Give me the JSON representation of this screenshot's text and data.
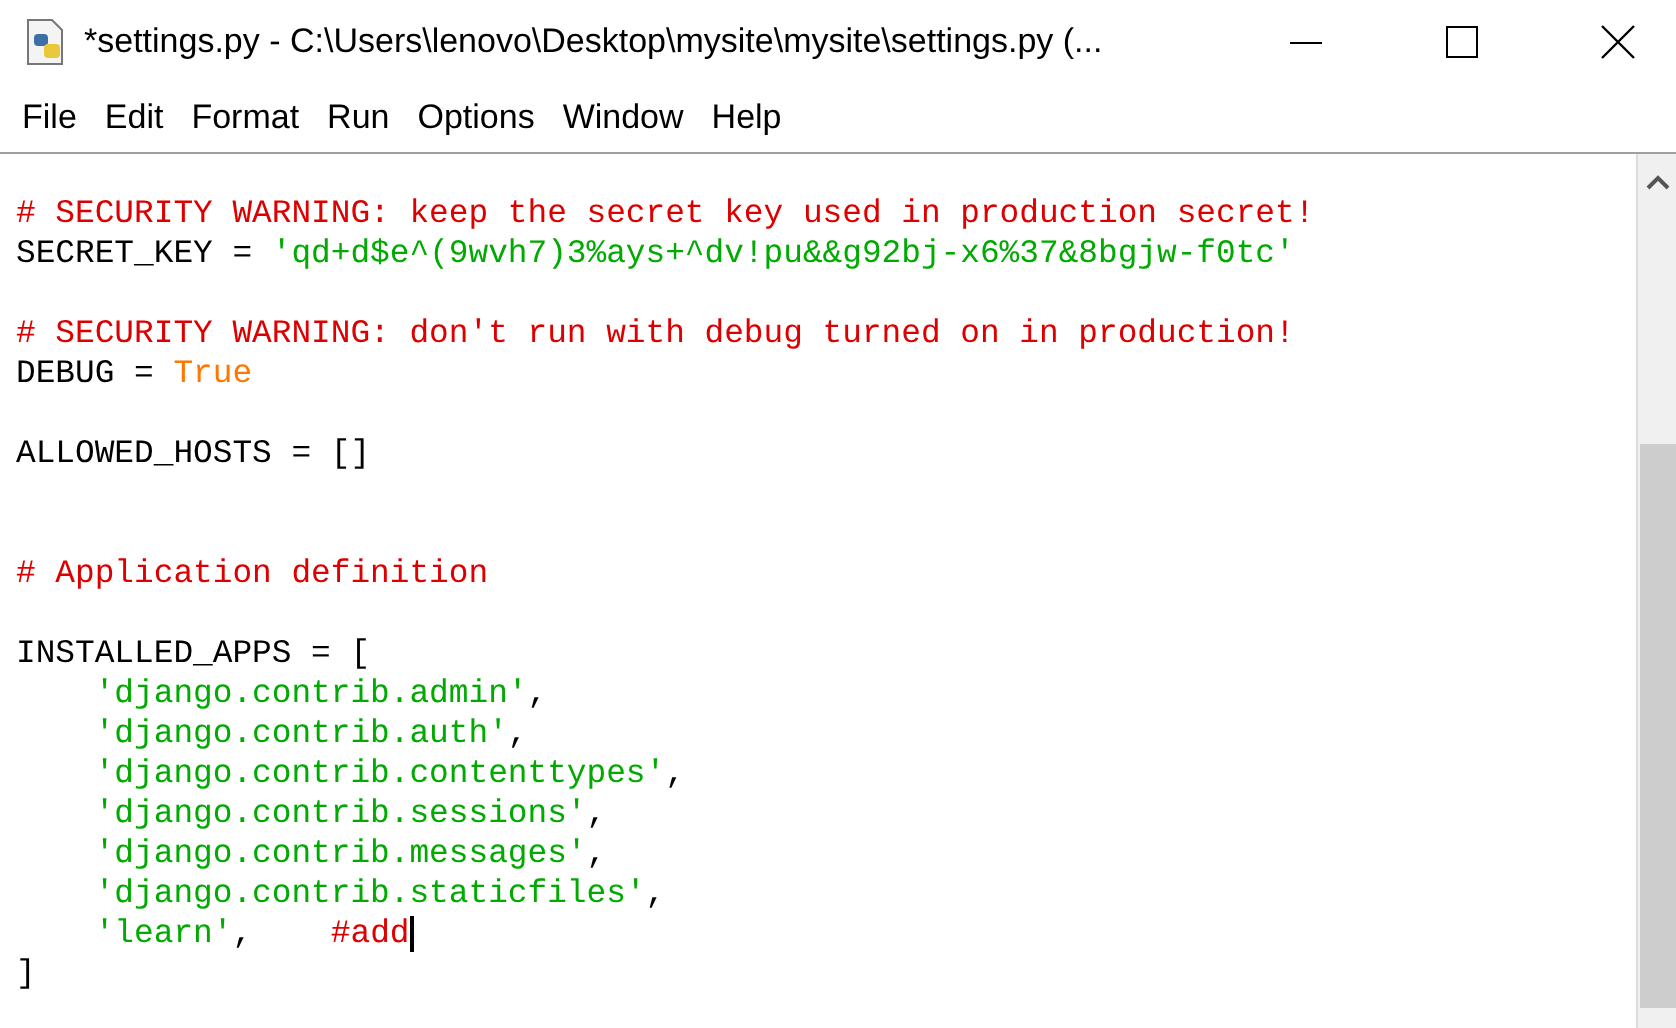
{
  "window": {
    "title": "*settings.py - C:\\Users\\lenovo\\Desktop\\mysite\\mysite\\settings.py (..."
  },
  "menu": [
    "File",
    "Edit",
    "Format",
    "Run",
    "Options",
    "Window",
    "Help"
  ],
  "editor": {
    "lines": [
      {
        "kind": "code",
        "tokens": [
          {
            "kind": "comment",
            "text": "# SECURITY WARNING: keep the secret key used in production secret!"
          }
        ]
      },
      {
        "kind": "code",
        "tokens": [
          {
            "kind": "plain",
            "text": "SECRET_KEY = "
          },
          {
            "kind": "string",
            "text": "'qd+d$e^(9wvh7)3%ays+^dv!pu&&g92bj-x6%37&8bgjw-f0tc'"
          }
        ]
      },
      {
        "kind": "blank"
      },
      {
        "kind": "code",
        "tokens": [
          {
            "kind": "comment",
            "text": "# SECURITY WARNING: don't run with debug turned on in production!"
          }
        ]
      },
      {
        "kind": "code",
        "tokens": [
          {
            "kind": "plain",
            "text": "DEBUG = "
          },
          {
            "kind": "keyword",
            "text": "True"
          }
        ]
      },
      {
        "kind": "blank"
      },
      {
        "kind": "code",
        "tokens": [
          {
            "kind": "plain",
            "text": "ALLOWED_HOSTS = []"
          }
        ]
      },
      {
        "kind": "blank"
      },
      {
        "kind": "blank"
      },
      {
        "kind": "code",
        "tokens": [
          {
            "kind": "comment",
            "text": "# Application definition"
          }
        ]
      },
      {
        "kind": "blank"
      },
      {
        "kind": "code",
        "tokens": [
          {
            "kind": "plain",
            "text": "INSTALLED_APPS = ["
          }
        ]
      },
      {
        "kind": "code",
        "tokens": [
          {
            "kind": "string",
            "text": "'django.contrib.admin'"
          },
          {
            "kind": "plain",
            "text": ","
          }
        ]
      },
      {
        "kind": "code",
        "tokens": [
          {
            "kind": "string",
            "text": "'django.contrib.auth'"
          },
          {
            "kind": "plain",
            "text": ","
          }
        ]
      },
      {
        "kind": "code",
        "tokens": [
          {
            "kind": "string",
            "text": "'django.contrib.contenttypes'"
          },
          {
            "kind": "plain",
            "text": ","
          }
        ]
      },
      {
        "kind": "code",
        "tokens": [
          {
            "kind": "string",
            "text": "'django.contrib.sessions'"
          },
          {
            "kind": "plain",
            "text": ","
          }
        ]
      },
      {
        "kind": "code",
        "tokens": [
          {
            "kind": "string",
            "text": "'django.contrib.messages'"
          },
          {
            "kind": "plain",
            "text": ","
          }
        ]
      },
      {
        "kind": "code",
        "tokens": [
          {
            "kind": "string",
            "text": "'django.contrib.staticfiles'"
          },
          {
            "kind": "plain",
            "text": ","
          }
        ]
      },
      {
        "kind": "code",
        "cursor": true,
        "tokens": [
          {
            "kind": "string",
            "text": "'learn'"
          },
          {
            "kind": "plain",
            "text": ","
          },
          {
            "kind": "comment",
            "text": "#add"
          }
        ]
      },
      {
        "kind": "code",
        "tokens": [
          {
            "kind": "plain",
            "text": "]"
          }
        ]
      }
    ]
  }
}
